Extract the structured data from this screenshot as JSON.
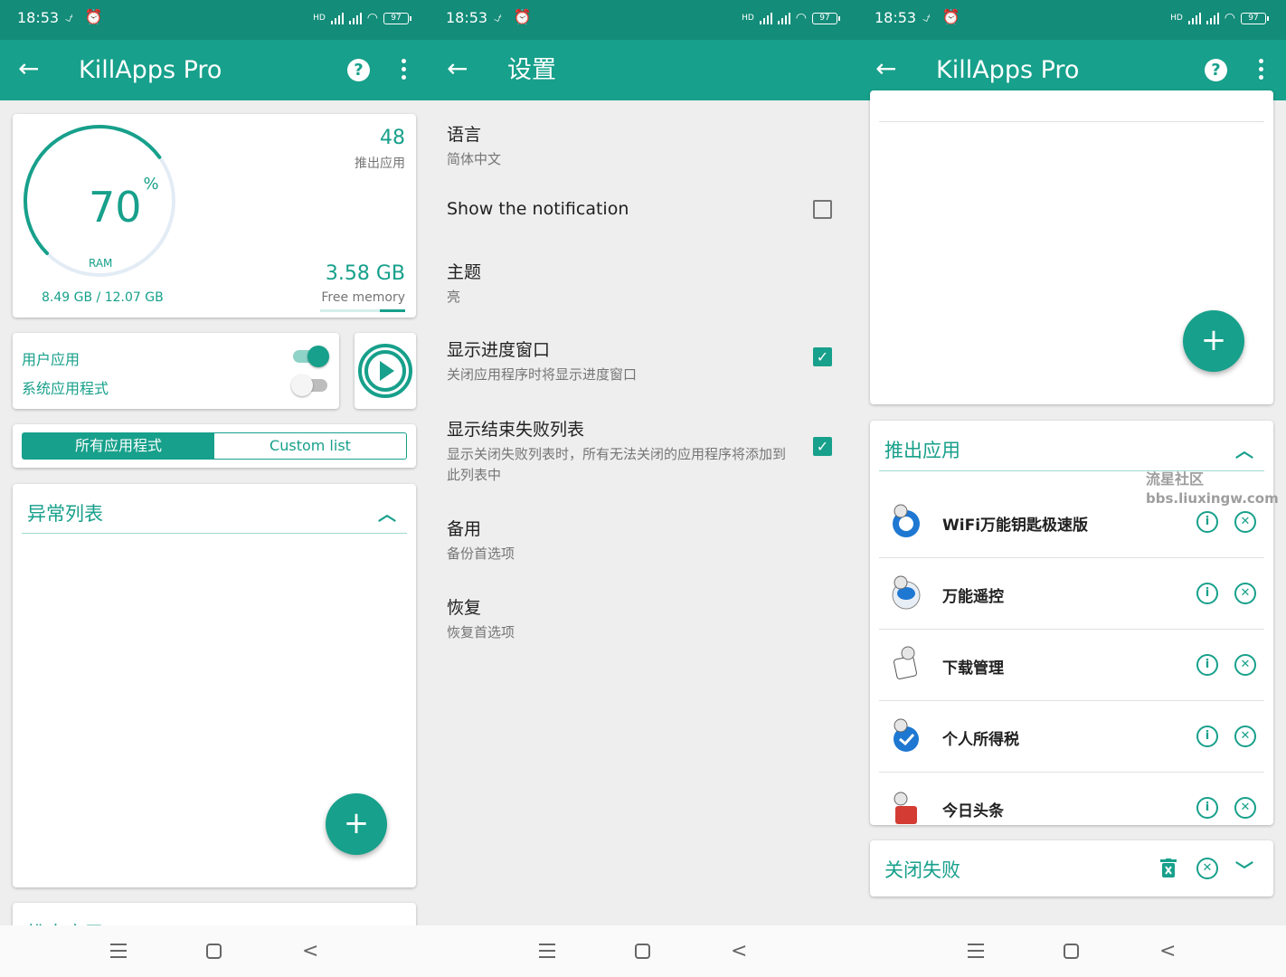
{
  "colors": {
    "accent": "#17a08b",
    "statusbar": "#138c79",
    "background": "#eeeeee"
  },
  "status_bar": {
    "time": "18:53",
    "icons": [
      "silent-icon",
      "alarm-icon"
    ],
    "network": "HD",
    "battery": "97"
  },
  "nav": {
    "icons": [
      "menu-icon",
      "home-icon",
      "back-icon"
    ]
  },
  "panel1": {
    "title": "KillApps Pro",
    "ram": {
      "percent": "70",
      "percent_sign": "%",
      "label": "RAM",
      "usage": "8.49 GB  /  12.07 GB",
      "gauge_fraction": 0.7
    },
    "killed": {
      "count": "48",
      "label": "推出应用"
    },
    "free": {
      "value": "3.58 GB",
      "label": "Free memory",
      "fraction": 0.3
    },
    "toggles": [
      {
        "label": "用户应用",
        "on": true
      },
      {
        "label": "系统应用程式",
        "on": false
      }
    ],
    "segment": {
      "all": "所有应用程式",
      "custom": "Custom list"
    },
    "section": {
      "title": "异常列表",
      "next_partial": "推出应用"
    },
    "fab": "+"
  },
  "panel2": {
    "title": "设置",
    "items": [
      {
        "title": "语言",
        "sub": "简体中文"
      },
      {
        "title": "Show the notification",
        "checked": false
      },
      {
        "title": "主题",
        "sub": "亮"
      },
      {
        "title": "显示进度窗口",
        "sub": "关闭应用程序时将显示进度窗口",
        "checked": true
      },
      {
        "title": "显示结束失败列表",
        "sub": "显示关闭失败列表时，所有无法关闭的应用程序将添加到此列表中",
        "checked": true
      },
      {
        "title": "备用",
        "sub": "备份首选项"
      },
      {
        "title": "恢复",
        "sub": "恢复首选项"
      }
    ]
  },
  "panel3": {
    "title": "KillApps Pro",
    "fab": "+",
    "kill_section": {
      "title": "推出应用"
    },
    "apps": [
      {
        "name": "WiFi万能钥匙极速版",
        "icon": "blue-circle"
      },
      {
        "name": "万能遥控",
        "icon": "blue-circle"
      },
      {
        "name": "下载管理",
        "icon": "paper"
      },
      {
        "name": "个人所得税",
        "icon": "blue-shield"
      },
      {
        "name": "今日头条",
        "icon": "red-square"
      }
    ],
    "fail_section": {
      "title": "关闭失败"
    },
    "watermark": {
      "line1": "流星社区",
      "line2": "bbs.liuxingw.com"
    }
  }
}
